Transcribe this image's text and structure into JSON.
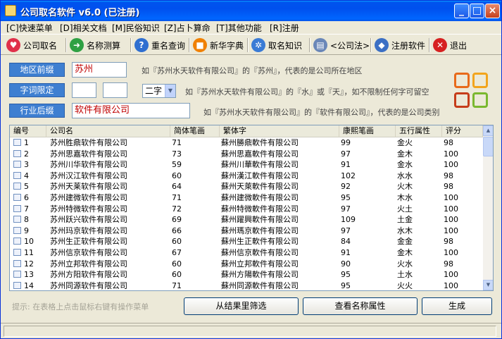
{
  "window": {
    "title": "公司取名软件 v6.0 (已注册)"
  },
  "title_buttons": {
    "minimize": "_",
    "maximize": "□",
    "close": "×"
  },
  "menu": [
    {
      "label": "[C]快速菜单"
    },
    {
      "label": "[D]相关文档"
    },
    {
      "label": "[M]民俗知识"
    },
    {
      "label": "[Z]占卜算命"
    },
    {
      "label": "[T]其他功能"
    },
    {
      "label": "[R]注册"
    }
  ],
  "toolbar": [
    {
      "label": "公司取名",
      "icon": "heart-icon",
      "color": "#e0304a",
      "glyph": "♥"
    },
    {
      "label": "名称测算",
      "icon": "arrow-right-icon",
      "color": "#2ea043",
      "glyph": "➜"
    },
    {
      "label": "重名查询",
      "icon": "help-icon",
      "color": "#2f6fd0",
      "glyph": "?"
    },
    {
      "label": "新华字典",
      "icon": "windows-icon",
      "color": "#f08000",
      "glyph": "■"
    },
    {
      "label": "取名知识",
      "icon": "gear-icon",
      "color": "#3a7bd5",
      "glyph": "✲"
    },
    {
      "label": "<公司法>",
      "icon": "document-icon",
      "color": "#6a87b8",
      "glyph": "▤"
    },
    {
      "label": "注册软件",
      "icon": "shield-icon",
      "color": "#3b6fc4",
      "glyph": "◆"
    },
    {
      "label": "退出",
      "icon": "close-icon",
      "color": "#d62020",
      "glyph": "✕"
    }
  ],
  "conditions": {
    "region": {
      "button": "地区前缀",
      "value": "苏州",
      "hint": "如『苏州水天软件有限公司』的『苏州』，代表的是公司所在地区"
    },
    "chars": {
      "button": "字词限定",
      "value1": "",
      "value2": "",
      "select": "二字",
      "hint": "如『苏州水天软件有限公司』的『水』或『天』，如不限制任何字可留空"
    },
    "industry": {
      "button": "行业后缀",
      "value": "软件有限公司",
      "hint": "如『苏州水天软件有限公司』的『软件有限公司』，代表的是公司类别"
    }
  },
  "table": {
    "columns": [
      "编号",
      "公司名",
      "简体笔画",
      "繁体字",
      "康熙笔画",
      "五行属性",
      "评分"
    ],
    "rows": [
      [
        "1",
        "苏州胜鼎软件有限公司",
        "71",
        "蘇州勝鼎軟件有限公司",
        "99",
        "金火",
        "98"
      ],
      [
        "2",
        "苏州思嘉软件有限公司",
        "73",
        "蘇州思嘉軟件有限公司",
        "97",
        "金木",
        "100"
      ],
      [
        "3",
        "苏州川华软件有限公司",
        "59",
        "蘇州川華軟件有限公司",
        "91",
        "金水",
        "100"
      ],
      [
        "4",
        "苏州汉江软件有限公司",
        "60",
        "蘇州漢江軟件有限公司",
        "102",
        "水水",
        "98"
      ],
      [
        "5",
        "苏州天莱软件有限公司",
        "64",
        "蘇州天萊軟件有限公司",
        "92",
        "火木",
        "98"
      ],
      [
        "6",
        "苏州建微软件有限公司",
        "71",
        "蘇州建微軟件有限公司",
        "95",
        "木水",
        "100"
      ],
      [
        "7",
        "苏州特微软件有限公司",
        "72",
        "蘇州特微軟件有限公司",
        "97",
        "火土",
        "100"
      ],
      [
        "8",
        "苏州跃兴软件有限公司",
        "69",
        "蘇州躍興軟件有限公司",
        "109",
        "土金",
        "100"
      ],
      [
        "9",
        "苏州玛京软件有限公司",
        "66",
        "蘇州瑪京軟件有限公司",
        "97",
        "水木",
        "100"
      ],
      [
        "10",
        "苏州生正软件有限公司",
        "60",
        "蘇州生正軟件有限公司",
        "84",
        "金金",
        "98"
      ],
      [
        "11",
        "苏州信京软件有限公司",
        "67",
        "蘇州信京軟件有限公司",
        "91",
        "金木",
        "100"
      ],
      [
        "12",
        "苏州立邦软件有限公司",
        "60",
        "蘇州立邦軟件有限公司",
        "90",
        "火水",
        "98"
      ],
      [
        "13",
        "苏州方阳软件有限公司",
        "60",
        "蘇州方陽軟件有限公司",
        "95",
        "土水",
        "100"
      ],
      [
        "14",
        "苏州同源软件有限公司",
        "71",
        "蘇州同源軟件有限公司",
        "95",
        "火火",
        "100"
      ]
    ]
  },
  "tip": "提示: 在表格上点击鼠标右键有操作菜单",
  "buttons": {
    "filter": "从结果里筛选",
    "view": "查看名称属性",
    "generate": "生成"
  }
}
